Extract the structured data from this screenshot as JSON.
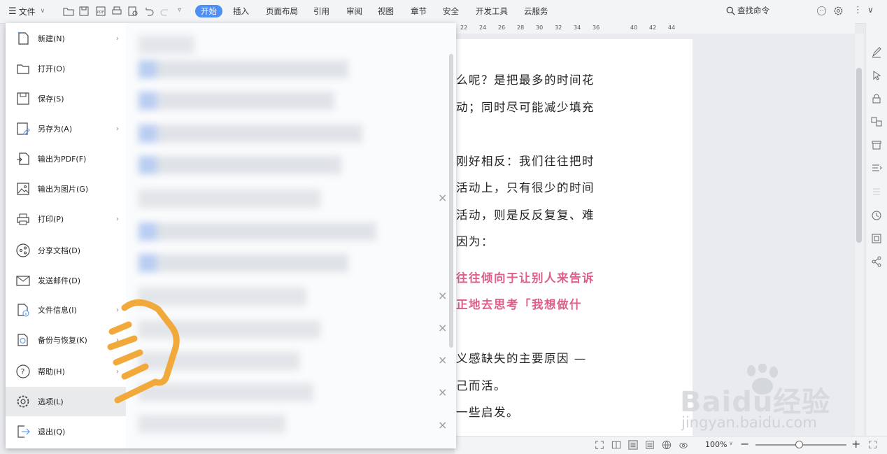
{
  "toolbar": {
    "file_label": "文件",
    "tabs": [
      "开始",
      "插入",
      "页面布局",
      "引用",
      "审阅",
      "视图",
      "章节",
      "安全",
      "开发工具",
      "云服务"
    ],
    "search_label": "查找命令"
  },
  "ruler": [
    "22",
    "24",
    "26",
    "28",
    "30",
    "32",
    "34",
    "36",
    "40",
    "42",
    "44"
  ],
  "menu": {
    "items": [
      {
        "label": "新建(N)",
        "arrow": "›"
      },
      {
        "label": "打开(O)",
        "arrow": ""
      },
      {
        "label": "保存(S)",
        "arrow": ""
      },
      {
        "label": "另存为(A)",
        "arrow": "›"
      },
      {
        "label": "输出为PDF(F)",
        "arrow": ""
      },
      {
        "label": "输出为图片(G)",
        "arrow": ""
      },
      {
        "label": "打印(P)",
        "arrow": "›"
      },
      {
        "label": "分享文档(D)",
        "arrow": ""
      },
      {
        "label": "发送邮件(D)",
        "arrow": ""
      },
      {
        "label": "文件信息(I)",
        "arrow": "›"
      },
      {
        "label": "备份与恢复(K)",
        "arrow": "›"
      },
      {
        "label": "帮助(H)",
        "arrow": "›"
      },
      {
        "label": "选项(L)",
        "arrow": ""
      },
      {
        "label": "退出(Q)",
        "arrow": ""
      }
    ],
    "close": "×"
  },
  "doc": {
    "lines": [
      "么呢？是把最多的时间花",
      "动；同时尽可能减少填充",
      "刚好相反：我们往往把时",
      "活动上，只有很少的时间",
      "活动，则是反反复复、难",
      "因为：",
      "往往倾向于让别人来告诉",
      "正地去思考「我想做什",
      "义感缺失的主要原因 —",
      "己而活。",
      "一些启发。"
    ]
  },
  "status": {
    "zoom": "100%"
  },
  "watermark": {
    "brand": "Baidu经验",
    "url": "jingyan.baidu.com"
  },
  "colors": {
    "accent": "#4d8ff5",
    "highlight": "#e05d8c",
    "hand": "#f2a93b"
  }
}
